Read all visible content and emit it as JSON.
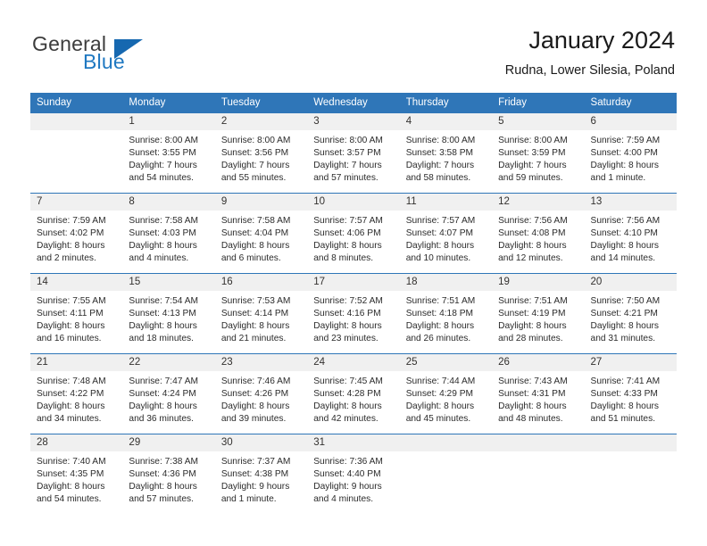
{
  "brand": {
    "name_part1": "General",
    "name_part2": "Blue",
    "flag_icon": "blue-triangle-flag-icon"
  },
  "header": {
    "title": "January 2024",
    "location": "Rudna, Lower Silesia, Poland"
  },
  "theme": {
    "header_blue": "#2f76b8",
    "daynum_band": "#f0f0f0",
    "logo_blue": "#1f78c1",
    "text": "#1a1a1a"
  },
  "weekday_headers": [
    "Sunday",
    "Monday",
    "Tuesday",
    "Wednesday",
    "Thursday",
    "Friday",
    "Saturday"
  ],
  "weeks": [
    [
      {
        "day": "",
        "lines": []
      },
      {
        "day": "1",
        "lines": [
          "Sunrise: 8:00 AM",
          "Sunset: 3:55 PM",
          "Daylight: 7 hours",
          "and 54 minutes."
        ]
      },
      {
        "day": "2",
        "lines": [
          "Sunrise: 8:00 AM",
          "Sunset: 3:56 PM",
          "Daylight: 7 hours",
          "and 55 minutes."
        ]
      },
      {
        "day": "3",
        "lines": [
          "Sunrise: 8:00 AM",
          "Sunset: 3:57 PM",
          "Daylight: 7 hours",
          "and 57 minutes."
        ]
      },
      {
        "day": "4",
        "lines": [
          "Sunrise: 8:00 AM",
          "Sunset: 3:58 PM",
          "Daylight: 7 hours",
          "and 58 minutes."
        ]
      },
      {
        "day": "5",
        "lines": [
          "Sunrise: 8:00 AM",
          "Sunset: 3:59 PM",
          "Daylight: 7 hours",
          "and 59 minutes."
        ]
      },
      {
        "day": "6",
        "lines": [
          "Sunrise: 7:59 AM",
          "Sunset: 4:00 PM",
          "Daylight: 8 hours",
          "and 1 minute."
        ]
      }
    ],
    [
      {
        "day": "7",
        "lines": [
          "Sunrise: 7:59 AM",
          "Sunset: 4:02 PM",
          "Daylight: 8 hours",
          "and 2 minutes."
        ]
      },
      {
        "day": "8",
        "lines": [
          "Sunrise: 7:58 AM",
          "Sunset: 4:03 PM",
          "Daylight: 8 hours",
          "and 4 minutes."
        ]
      },
      {
        "day": "9",
        "lines": [
          "Sunrise: 7:58 AM",
          "Sunset: 4:04 PM",
          "Daylight: 8 hours",
          "and 6 minutes."
        ]
      },
      {
        "day": "10",
        "lines": [
          "Sunrise: 7:57 AM",
          "Sunset: 4:06 PM",
          "Daylight: 8 hours",
          "and 8 minutes."
        ]
      },
      {
        "day": "11",
        "lines": [
          "Sunrise: 7:57 AM",
          "Sunset: 4:07 PM",
          "Daylight: 8 hours",
          "and 10 minutes."
        ]
      },
      {
        "day": "12",
        "lines": [
          "Sunrise: 7:56 AM",
          "Sunset: 4:08 PM",
          "Daylight: 8 hours",
          "and 12 minutes."
        ]
      },
      {
        "day": "13",
        "lines": [
          "Sunrise: 7:56 AM",
          "Sunset: 4:10 PM",
          "Daylight: 8 hours",
          "and 14 minutes."
        ]
      }
    ],
    [
      {
        "day": "14",
        "lines": [
          "Sunrise: 7:55 AM",
          "Sunset: 4:11 PM",
          "Daylight: 8 hours",
          "and 16 minutes."
        ]
      },
      {
        "day": "15",
        "lines": [
          "Sunrise: 7:54 AM",
          "Sunset: 4:13 PM",
          "Daylight: 8 hours",
          "and 18 minutes."
        ]
      },
      {
        "day": "16",
        "lines": [
          "Sunrise: 7:53 AM",
          "Sunset: 4:14 PM",
          "Daylight: 8 hours",
          "and 21 minutes."
        ]
      },
      {
        "day": "17",
        "lines": [
          "Sunrise: 7:52 AM",
          "Sunset: 4:16 PM",
          "Daylight: 8 hours",
          "and 23 minutes."
        ]
      },
      {
        "day": "18",
        "lines": [
          "Sunrise: 7:51 AM",
          "Sunset: 4:18 PM",
          "Daylight: 8 hours",
          "and 26 minutes."
        ]
      },
      {
        "day": "19",
        "lines": [
          "Sunrise: 7:51 AM",
          "Sunset: 4:19 PM",
          "Daylight: 8 hours",
          "and 28 minutes."
        ]
      },
      {
        "day": "20",
        "lines": [
          "Sunrise: 7:50 AM",
          "Sunset: 4:21 PM",
          "Daylight: 8 hours",
          "and 31 minutes."
        ]
      }
    ],
    [
      {
        "day": "21",
        "lines": [
          "Sunrise: 7:48 AM",
          "Sunset: 4:22 PM",
          "Daylight: 8 hours",
          "and 34 minutes."
        ]
      },
      {
        "day": "22",
        "lines": [
          "Sunrise: 7:47 AM",
          "Sunset: 4:24 PM",
          "Daylight: 8 hours",
          "and 36 minutes."
        ]
      },
      {
        "day": "23",
        "lines": [
          "Sunrise: 7:46 AM",
          "Sunset: 4:26 PM",
          "Daylight: 8 hours",
          "and 39 minutes."
        ]
      },
      {
        "day": "24",
        "lines": [
          "Sunrise: 7:45 AM",
          "Sunset: 4:28 PM",
          "Daylight: 8 hours",
          "and 42 minutes."
        ]
      },
      {
        "day": "25",
        "lines": [
          "Sunrise: 7:44 AM",
          "Sunset: 4:29 PM",
          "Daylight: 8 hours",
          "and 45 minutes."
        ]
      },
      {
        "day": "26",
        "lines": [
          "Sunrise: 7:43 AM",
          "Sunset: 4:31 PM",
          "Daylight: 8 hours",
          "and 48 minutes."
        ]
      },
      {
        "day": "27",
        "lines": [
          "Sunrise: 7:41 AM",
          "Sunset: 4:33 PM",
          "Daylight: 8 hours",
          "and 51 minutes."
        ]
      }
    ],
    [
      {
        "day": "28",
        "lines": [
          "Sunrise: 7:40 AM",
          "Sunset: 4:35 PM",
          "Daylight: 8 hours",
          "and 54 minutes."
        ]
      },
      {
        "day": "29",
        "lines": [
          "Sunrise: 7:38 AM",
          "Sunset: 4:36 PM",
          "Daylight: 8 hours",
          "and 57 minutes."
        ]
      },
      {
        "day": "30",
        "lines": [
          "Sunrise: 7:37 AM",
          "Sunset: 4:38 PM",
          "Daylight: 9 hours",
          "and 1 minute."
        ]
      },
      {
        "day": "31",
        "lines": [
          "Sunrise: 7:36 AM",
          "Sunset: 4:40 PM",
          "Daylight: 9 hours",
          "and 4 minutes."
        ]
      },
      {
        "day": "",
        "lines": []
      },
      {
        "day": "",
        "lines": []
      },
      {
        "day": "",
        "lines": []
      }
    ]
  ]
}
